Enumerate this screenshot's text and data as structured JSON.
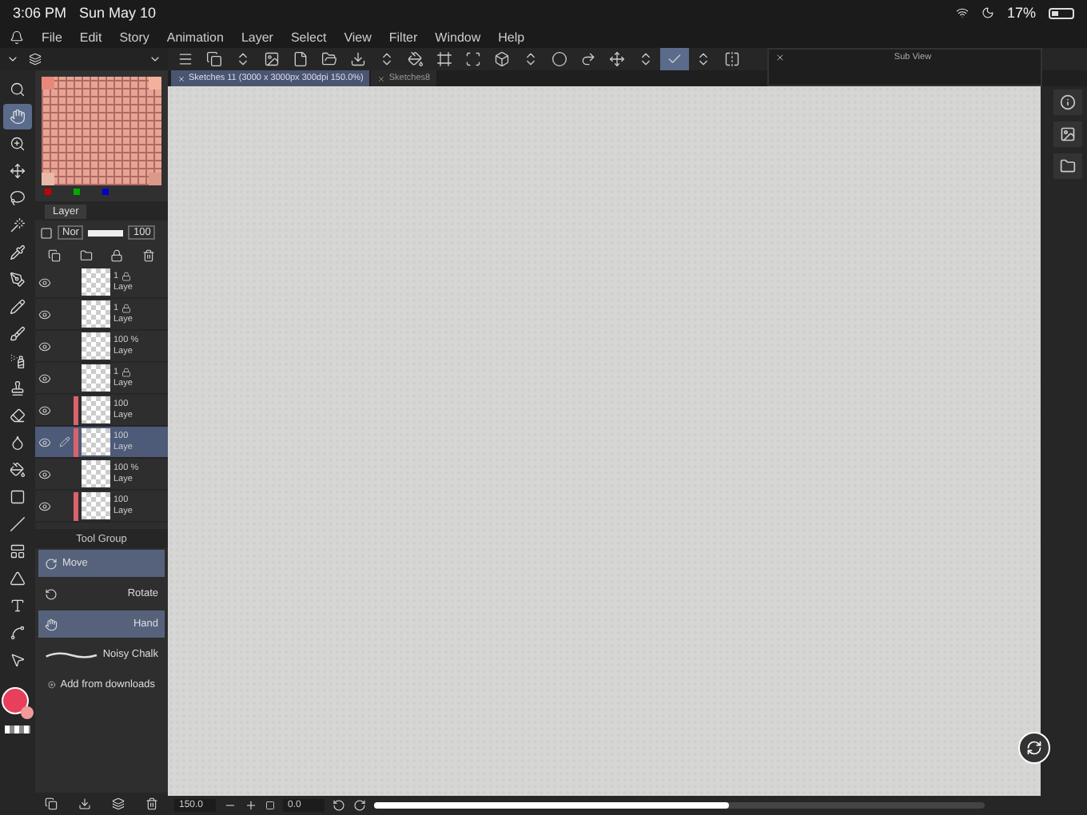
{
  "status_bar": {
    "time": "3:06 PM",
    "date": "Sun May 10",
    "battery": "17%"
  },
  "menu": [
    "File",
    "Edit",
    "Story",
    "Animation",
    "Layer",
    "Select",
    "View",
    "Filter",
    "Window",
    "Help"
  ],
  "tools": [
    {
      "kind": "search",
      "selected": false
    },
    {
      "kind": "hand",
      "selected": true
    },
    {
      "kind": "zoom",
      "selected": false
    },
    {
      "kind": "move",
      "selected": false
    },
    {
      "kind": "lasso",
      "selected": false
    },
    {
      "kind": "wand",
      "selected": false
    },
    {
      "kind": "pipette",
      "selected": false
    },
    {
      "kind": "pen",
      "selected": false
    },
    {
      "kind": "pencil",
      "selected": false
    },
    {
      "kind": "brush",
      "selected": false
    },
    {
      "kind": "spray",
      "selected": false
    },
    {
      "kind": "stamp",
      "selected": false
    },
    {
      "kind": "eraser",
      "selected": false
    },
    {
      "kind": "blend",
      "selected": false
    },
    {
      "kind": "bucket",
      "selected": false
    },
    {
      "kind": "gradient",
      "selected": false
    },
    {
      "kind": "line",
      "selected": false
    },
    {
      "kind": "frame",
      "selected": false
    },
    {
      "kind": "ruler",
      "selected": false
    },
    {
      "kind": "text",
      "selected": false
    },
    {
      "kind": "spline",
      "selected": false
    },
    {
      "kind": "pointer",
      "selected": false
    }
  ],
  "toolbar": [
    {
      "kind": "menu",
      "selected": false
    },
    {
      "kind": "layers",
      "selected": false
    },
    {
      "kind": "updown",
      "selected": false
    },
    {
      "kind": "image",
      "selected": false
    },
    {
      "kind": "page",
      "selected": false
    },
    {
      "kind": "folder",
      "selected": false
    },
    {
      "kind": "download",
      "selected": false
    },
    {
      "kind": "updown",
      "selected": false
    },
    {
      "kind": "bucket",
      "selected": false
    },
    {
      "kind": "frame",
      "selected": false
    },
    {
      "kind": "scan",
      "selected": false
    },
    {
      "kind": "box",
      "selected": false
    },
    {
      "kind": "updown",
      "selected": false
    },
    {
      "kind": "circle",
      "selected": false
    },
    {
      "kind": "redo",
      "selected": false
    },
    {
      "kind": "move",
      "selected": false
    },
    {
      "kind": "updown",
      "selected": false
    },
    {
      "kind": "check",
      "selected": true
    },
    {
      "kind": "updown",
      "selected": false
    },
    {
      "kind": "flip",
      "selected": false
    }
  ],
  "sub_view": {
    "title": "Sub View"
  },
  "document_tabs": [
    {
      "label": "Sketches 11 (3000 x 3000px 300dpi 150.0%)",
      "selected": true
    },
    {
      "label": "Sketches8",
      "selected": false
    }
  ],
  "layer_panel": {
    "tab": "Layer",
    "blend_mode": "Nor",
    "opacity": "100",
    "opacity_slider": {
      "level": 1
    },
    "layers": [
      {
        "opacity": "1",
        "name": "Laye",
        "locked": true,
        "tagged": false,
        "visible": true,
        "selected": false
      },
      {
        "opacity": "1",
        "name": "Laye",
        "locked": true,
        "tagged": false,
        "visible": true,
        "selected": false
      },
      {
        "opacity": "100 %",
        "name": "Laye",
        "locked": false,
        "tagged": false,
        "visible": true,
        "selected": false
      },
      {
        "opacity": "1",
        "name": "Laye",
        "locked": true,
        "tagged": false,
        "visible": true,
        "selected": false
      },
      {
        "opacity": "100",
        "name": "Laye",
        "locked": false,
        "tagged": true,
        "visible": true,
        "selected": false
      },
      {
        "opacity": "100",
        "name": "Laye",
        "locked": false,
        "tagged": true,
        "visible": true,
        "selected": true
      },
      {
        "opacity": "100 %",
        "name": "Laye",
        "locked": false,
        "tagged": false,
        "visible": true,
        "selected": false
      },
      {
        "opacity": "100",
        "name": "Laye",
        "locked": false,
        "tagged": true,
        "visible": true,
        "selected": false
      }
    ]
  },
  "tool_group": {
    "title": "Tool Group",
    "items": [
      {
        "label": "Move",
        "kind": "group",
        "selected": true
      },
      {
        "label": "Rotate",
        "kind": "tool",
        "selected": false
      },
      {
        "label": "Hand",
        "kind": "tool",
        "selected": true
      },
      {
        "label": "Noisy Chalk",
        "kind": "brush",
        "selected": false
      }
    ],
    "add_label": "Add from downloads"
  },
  "navigator": {
    "zoom": "150.0",
    "angle": "0.0"
  }
}
